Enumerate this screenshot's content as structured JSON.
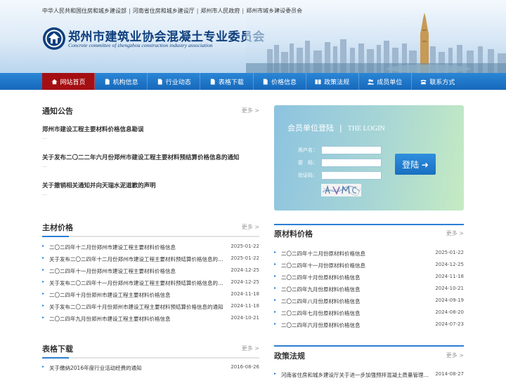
{
  "header": {
    "top_links": [
      "中华人民共和国住房和城乡建设部",
      "河南省住房和城乡建设厅",
      "郑州市人民政府",
      "郑州市城乡建设委员会"
    ],
    "separator": "|",
    "site_title": "郑州市建筑业协会混凝土专业委员会",
    "site_subtitle": "Concrete committee of zhengzhou construction industry association"
  },
  "nav": {
    "items": [
      {
        "label": "网站首页",
        "icon": "home-icon",
        "active": true
      },
      {
        "label": "机构信息",
        "icon": "document-icon",
        "active": false
      },
      {
        "label": "行业动态",
        "icon": "document-icon",
        "active": false
      },
      {
        "label": "表格下载",
        "icon": "document-icon",
        "active": false
      },
      {
        "label": "价格信息",
        "icon": "document-icon",
        "active": false
      },
      {
        "label": "政策法规",
        "icon": "book-icon",
        "active": false
      },
      {
        "label": "成员单位",
        "icon": "group-icon",
        "active": false
      },
      {
        "label": "联系方式",
        "icon": "phone-icon",
        "active": false
      }
    ]
  },
  "more_label": "更多 >",
  "notices": {
    "title": "通知公告",
    "dots": "...",
    "items": [
      "郑州市建设工程主要材料价格信息勘误",
      "关于发布二〇二二年六月份郑州市建设工程主要材料预结算价格信息的通知",
      "关于撤销相关通知并向天瑞水泥道歉的声明"
    ]
  },
  "login": {
    "title_cn": "会员单位登陆",
    "title_sep": "|",
    "title_en": "THE LOGIN",
    "username_label": "用户名：",
    "password_label": "密　码：",
    "captcha_label": "验证码：",
    "button_label": "登陆 ➜"
  },
  "material_prices": {
    "title": "主材价格",
    "items": [
      {
        "text": "二〇二四年十二月份郑州市建设工程主要材料价格信息",
        "date": "2025-01-22"
      },
      {
        "text": "关于发布二〇二四年十二月份郑州市建设工程主要材料预结算价格信息的通知",
        "date": "2025-01-22"
      },
      {
        "text": "二〇二四年十一月份郑州市建设工程主要材料价格信息",
        "date": "2024-12-25"
      },
      {
        "text": "关于发布二〇二四年十一月份郑州市建设工程主要材料预结算价格信息的通知",
        "date": "2024-12-25"
      },
      {
        "text": "二〇二四年十月份郑州市建设工程主要材料价格信息",
        "date": "2024-11-18"
      },
      {
        "text": "关于发布二〇二四年十月份郑州市建设工程主要材料预结算价格信息的通知",
        "date": "2024-11-18"
      },
      {
        "text": "二〇二四年九月份郑州市建设工程主要材料价格信息",
        "date": "2024-10-21"
      }
    ]
  },
  "raw_prices": {
    "title": "原材料价格",
    "items": [
      {
        "text": "二〇二四年十二月份原材料价格信息",
        "date": "2025-01-22"
      },
      {
        "text": "二〇二四年十一月份原材料价格信息",
        "date": "2024-12-25"
      },
      {
        "text": "二〇二四年十月份原材料价格信息",
        "date": "2024-11-18"
      },
      {
        "text": "二〇二四年九月份原材料价格信息",
        "date": "2024-10-21"
      },
      {
        "text": "二〇二四年八月份原材料价格信息",
        "date": "2024-09-19"
      },
      {
        "text": "二〇二四年七月份原材料价格信息",
        "date": "2024-08-20"
      },
      {
        "text": "二〇二四年六月份原材料价格信息",
        "date": "2024-07-23"
      }
    ]
  },
  "downloads": {
    "title": "表格下载",
    "items": [
      {
        "text": "关于缴纳2016年度行业活动经费的通知",
        "date": "2016-08-26"
      }
    ]
  },
  "policies": {
    "title": "政策法规",
    "items": [
      {
        "text": "河南省住房和城乡建设厅关于进一步加强预拌混凝土质量管理工...",
        "date": "2014-08-27"
      }
    ]
  },
  "colors": {
    "nav_blue": "#1d74c6",
    "nav_active": "#a50f13",
    "accent_blue": "#2a7ed3",
    "title_blue": "#0f3f7d"
  }
}
